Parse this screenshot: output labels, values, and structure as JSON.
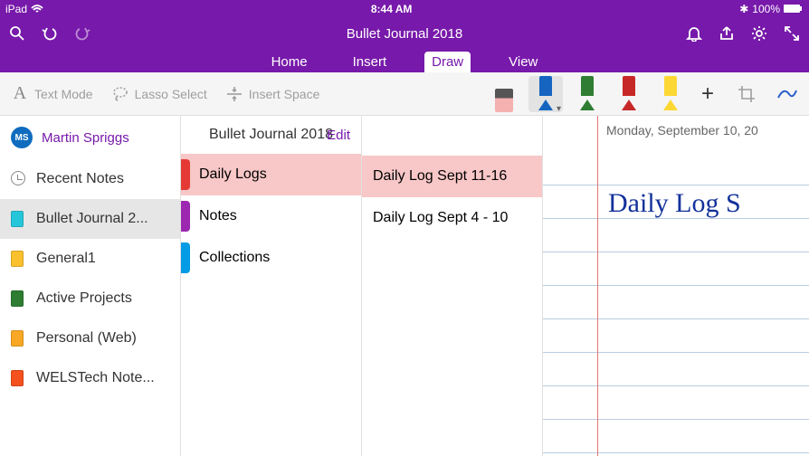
{
  "status": {
    "device": "iPad",
    "time": "8:44 AM",
    "bluetooth": "✱",
    "battery_pct": "100%"
  },
  "titlebar": {
    "title": "Bullet Journal 2018"
  },
  "menu": {
    "items": [
      "Home",
      "Insert",
      "Draw",
      "View"
    ],
    "active": "Draw"
  },
  "ribbon": {
    "text_mode": "Text Mode",
    "lasso": "Lasso Select",
    "insert_space": "Insert Space",
    "pens": [
      {
        "type": "eraser",
        "selected": false
      },
      {
        "type": "pen",
        "color": "blue",
        "selected": true
      },
      {
        "type": "pen",
        "color": "green",
        "selected": false
      },
      {
        "type": "pen",
        "color": "red",
        "selected": false
      },
      {
        "type": "highlighter",
        "color": "yellow",
        "selected": false
      }
    ]
  },
  "user": {
    "initials": "MS",
    "name": "Martin Spriggs"
  },
  "sidebar": {
    "recent": "Recent Notes",
    "notebooks": [
      {
        "label": "Bullet Journal 2...",
        "color": "cyan",
        "selected": true
      },
      {
        "label": "General1",
        "color": "yellow"
      },
      {
        "label": "Active Projects",
        "color": "green"
      },
      {
        "label": "Personal (Web)",
        "color": "amber"
      },
      {
        "label": "WELSTech Note...",
        "color": "orange"
      }
    ]
  },
  "sections": {
    "title": "Bullet Journal 2018",
    "edit": "Edit",
    "items": [
      {
        "label": "Daily Logs",
        "tab": "red",
        "selected": true
      },
      {
        "label": "Notes",
        "tab": "purple"
      },
      {
        "label": "Collections",
        "tab": "blue"
      }
    ]
  },
  "pages": {
    "items": [
      {
        "label": "Daily Log Sept 11-16",
        "selected": true
      },
      {
        "label": "Daily Log Sept 4 - 10"
      }
    ]
  },
  "canvas": {
    "date": "Monday, September 10, 20",
    "handwriting": "Daily Log S"
  }
}
